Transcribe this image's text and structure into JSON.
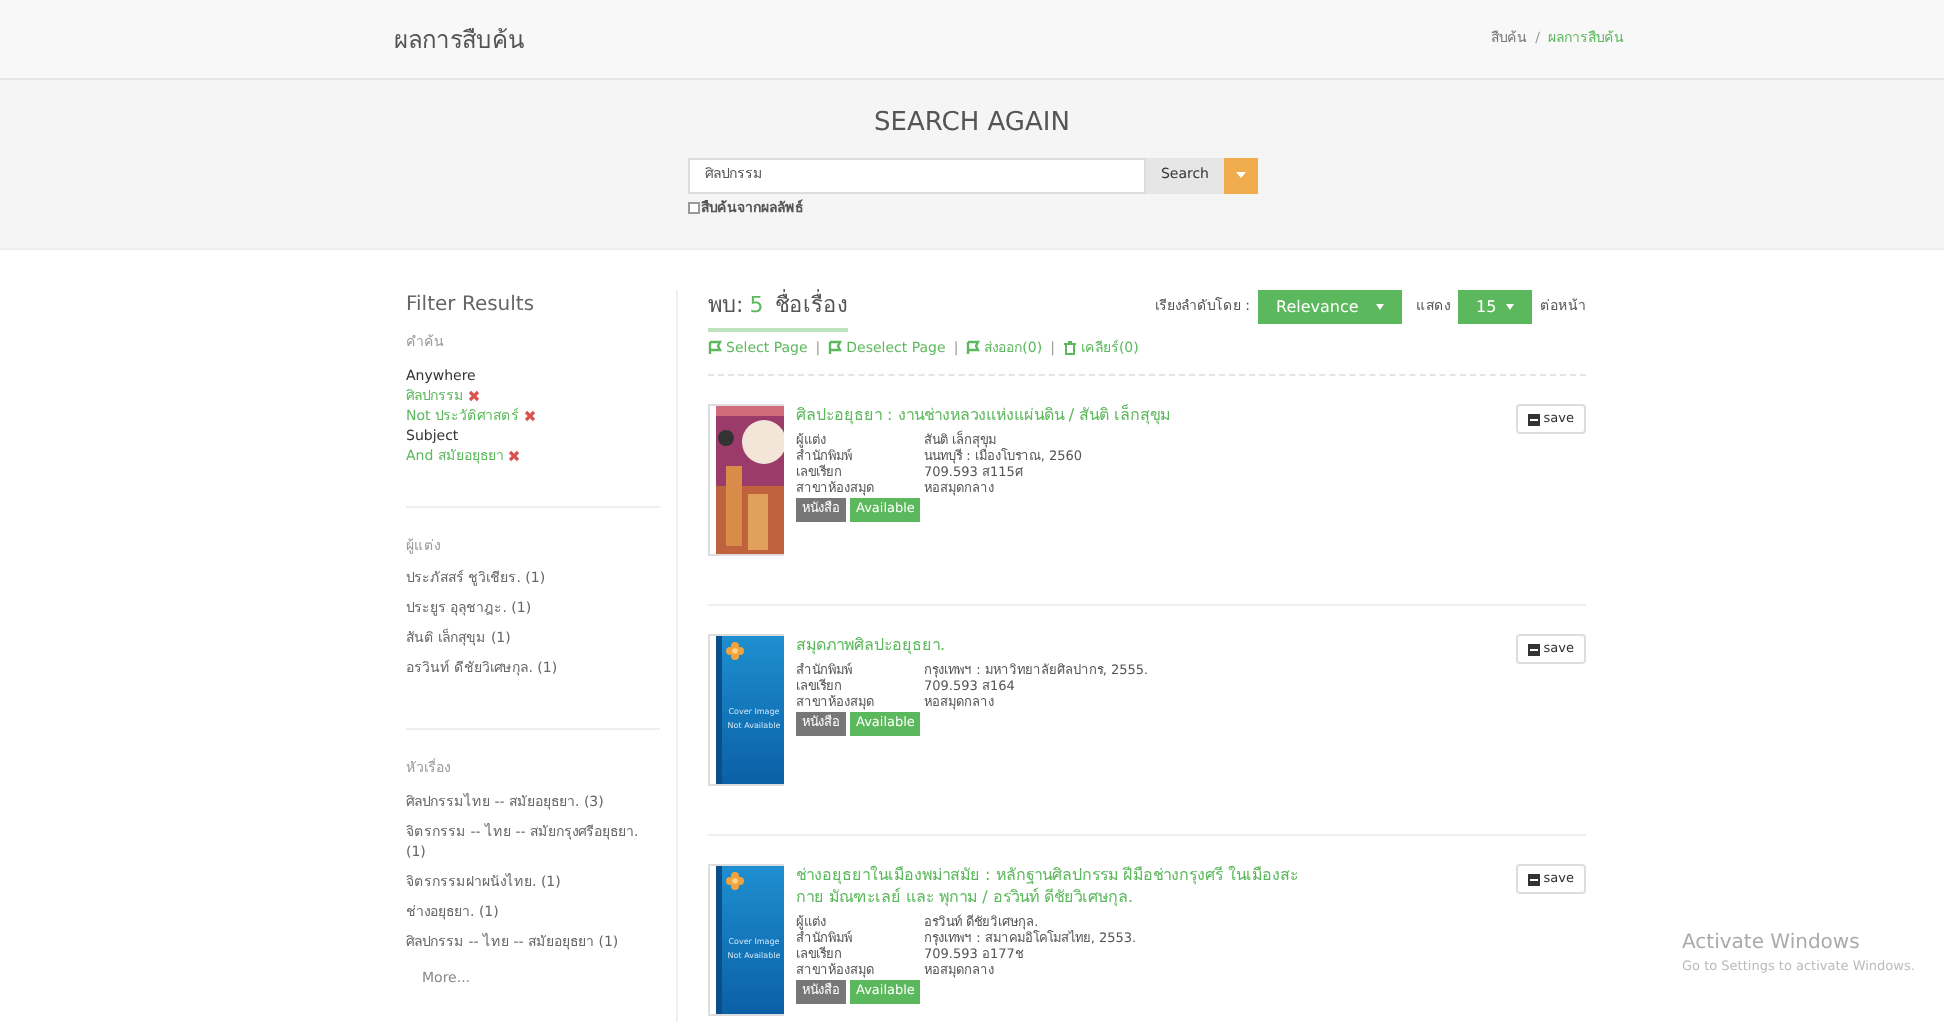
{
  "header": {
    "title": "ผลการสืบค้น",
    "separator": "/",
    "breadcrumb": [
      {
        "label": "สืบค้น",
        "selected": false
      },
      {
        "label": "ผลการสืบค้น",
        "selected": true
      }
    ]
  },
  "search": {
    "heading": "SEARCH AGAIN",
    "value": "ศิลปกรรม",
    "button": "Search",
    "within_results": {
      "label": "สืบค้นจากผลลัพธ์",
      "checked": false
    }
  },
  "filters": {
    "title": "Filter Results",
    "sections": [
      {
        "heading": "คำค้น",
        "items": [
          {
            "kind": "label",
            "text": "Anywhere"
          },
          {
            "kind": "term",
            "text": "ศิลปกรรม"
          },
          {
            "kind": "term",
            "text": "Not ประวัติศาสตร์"
          },
          {
            "kind": "label",
            "text": "Subject"
          },
          {
            "kind": "term",
            "text": "And สมัยอยุธยา"
          }
        ]
      },
      {
        "heading": "ผู้แต่ง",
        "items": [
          {
            "kind": "facet",
            "text": "ประภัสสร์ ชูวิเชียร. (1)"
          },
          {
            "kind": "facet",
            "text": "ประยูร อุลุชาฎะ. (1)"
          },
          {
            "kind": "facet",
            "text": "สันติ เล็กสุขุม (1)"
          },
          {
            "kind": "facet",
            "text": "อรวินท์ ดีชัยวิเศษกุล. (1)"
          }
        ]
      },
      {
        "heading": "หัวเรื่อง",
        "items": [
          {
            "kind": "facet",
            "text": "ศิลปกรรมไทย -- สมัยอยุธยา. (3)"
          },
          {
            "kind": "facet",
            "text": "จิตรกรรม -- ไทย -- สมัยกรุงศรีอยุธยา. (1)"
          },
          {
            "kind": "facet",
            "text": "จิตรกรรมฝาผนังไทย. (1)"
          },
          {
            "kind": "facet",
            "text": "ช่างอยุธยา. (1)"
          },
          {
            "kind": "facet",
            "text": "ศิลปกรรม -- ไทย -- สมัยอยุธยา (1)"
          },
          {
            "kind": "more",
            "text": "More..."
          }
        ]
      }
    ]
  },
  "results": {
    "found_label": "พบ:",
    "count": "5",
    "found_unit": "ชื่อเรื่อง",
    "actions": [
      "Select Page",
      "Deselect Page",
      "ส่งออก(0)",
      "เคลียร์(0)"
    ],
    "action_separators": [
      "|",
      "|",
      "|"
    ],
    "sort_label": "เรียงลำดับโดย :",
    "sort": "Relevance",
    "show_label": "แสดง",
    "per_page": "15",
    "per_page_suffix": "ต่อหน้า",
    "items": [
      {
        "cover": {
          "kind": "picture"
        },
        "title": "ศิลปะอยุธยา : งานช่างหลวงแห่งแผ่นดิน / สันติ เล็กสุขุม",
        "fields": [
          {
            "label": "ผู้แต่ง",
            "value": "สันติ เล็กสุขุม"
          },
          {
            "label": "สำนักพิมพ์",
            "value": "นนทบุรี : เมืองโบราณ, 2560"
          },
          {
            "label": "เลขเรียก",
            "value": "709.593 ส115ศ"
          },
          {
            "label": "สาขาห้องสมุด",
            "value": "หอสมุดกลาง"
          }
        ],
        "badges": [
          {
            "text": "หนังสือ",
            "color": "#777777"
          },
          {
            "text": "Available",
            "color": "#5cb85c"
          }
        ],
        "save": "save"
      },
      {
        "cover": {
          "kind": "placeholder",
          "lines": [
            "Cover Image",
            "Not Available"
          ]
        },
        "title": "สมุดภาพศิลปะอยุธยา.",
        "fields": [
          {
            "label": "สำนักพิมพ์",
            "value": "กรุงเทพฯ : มหาวิทยาลัยศิลปากร, 2555."
          },
          {
            "label": "เลขเรียก",
            "value": "709.593 ส164"
          },
          {
            "label": "สาขาห้องสมุด",
            "value": "หอสมุดกลาง"
          }
        ],
        "badges": [
          {
            "text": "หนังสือ",
            "color": "#777777"
          },
          {
            "text": "Available",
            "color": "#5cb85c"
          }
        ],
        "save": "save"
      },
      {
        "cover": {
          "kind": "placeholder",
          "lines": [
            "Cover Image",
            "Not Available"
          ]
        },
        "title": "ช่างอยุธยาในเมืองพม่าสมัย : หลักฐานศิลปกรรม ฝีมือช่างกรุงศรี ในเมืองสะกาย มัณฑะเลย์ และ พุกาม / อรวินท์ ดีชัยวิเศษกุล.",
        "fields": [
          {
            "label": "ผู้แต่ง",
            "value": "อรวินท์ ดีชัยวิเศษกุล."
          },
          {
            "label": "สำนักพิมพ์",
            "value": "กรุงเทพฯ : สมาคมอิโคโมสไทย, 2553."
          },
          {
            "label": "เลขเรียก",
            "value": "709.593 อ177ช"
          },
          {
            "label": "สาขาห้องสมุด",
            "value": "หอสมุดกลาง"
          }
        ],
        "badges": [
          {
            "text": "หนังสือ",
            "color": "#777777"
          },
          {
            "text": "Available",
            "color": "#5cb85c"
          }
        ],
        "save": "save"
      }
    ]
  },
  "os_notice": {
    "title": "Activate Windows",
    "text": "Go to Settings to activate Windows."
  }
}
